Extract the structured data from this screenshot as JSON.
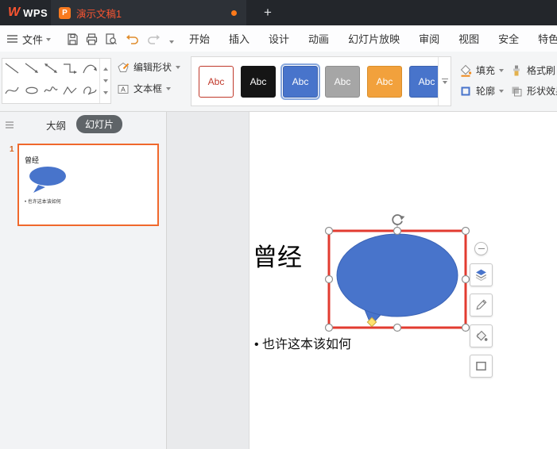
{
  "titlebar": {
    "logo": {
      "mark": "W",
      "text": "WPS"
    },
    "doc_tab": {
      "title": "演示文稿1",
      "file_icon_letter": "P"
    },
    "new_tab_label": "+"
  },
  "menubar": {
    "file_label": "文件",
    "tabs": [
      {
        "label": "开始"
      },
      {
        "label": "插入"
      },
      {
        "label": "设计"
      },
      {
        "label": "动画"
      },
      {
        "label": "幻灯片放映"
      },
      {
        "label": "审阅"
      },
      {
        "label": "视图"
      },
      {
        "label": "安全"
      },
      {
        "label": "特色"
      }
    ]
  },
  "ribbon": {
    "edit_shape_label": "编辑形状",
    "text_box_label": "文本框",
    "style_gallery": [
      {
        "label": "Abc",
        "bg": "#ffffff",
        "fg": "#c0392b",
        "border": "#c0392b",
        "selected": false
      },
      {
        "label": "Abc",
        "bg": "#151515",
        "fg": "#ffffff",
        "border": "#151515",
        "selected": false
      },
      {
        "label": "Abc",
        "bg": "#4874cb",
        "fg": "#ffffff",
        "border": "#3c62ad",
        "selected": true
      },
      {
        "label": "Abc",
        "bg": "#a6a6a6",
        "fg": "#ffffff",
        "border": "#8f8f8f",
        "selected": false
      },
      {
        "label": "Abc",
        "bg": "#f2a13c",
        "fg": "#ffffff",
        "border": "#d98e2b",
        "selected": false
      },
      {
        "label": "Abc",
        "bg": "#4874cb",
        "fg": "#ffffff",
        "border": "#3c62ad",
        "selected": false
      }
    ],
    "fill_label": "填充",
    "format_painter_label": "格式刷",
    "outline_label": "轮廓",
    "shape_effects_label": "形状效果",
    "icons": {
      "text_box_glyph": "A"
    }
  },
  "sidebar": {
    "outline_tab": "大纲",
    "slides_tab": "幻灯片",
    "slide_number": "1"
  },
  "slide": {
    "title": "曾经",
    "bullet": "• 也许这本该如何"
  },
  "colors": {
    "shape_blue": "#4874cb",
    "selection_red": "#e23b30",
    "wps_orange": "#fc5531",
    "thumb_border_orange": "#f0682c",
    "adjust_handle_yellow": "#ffe16e"
  }
}
